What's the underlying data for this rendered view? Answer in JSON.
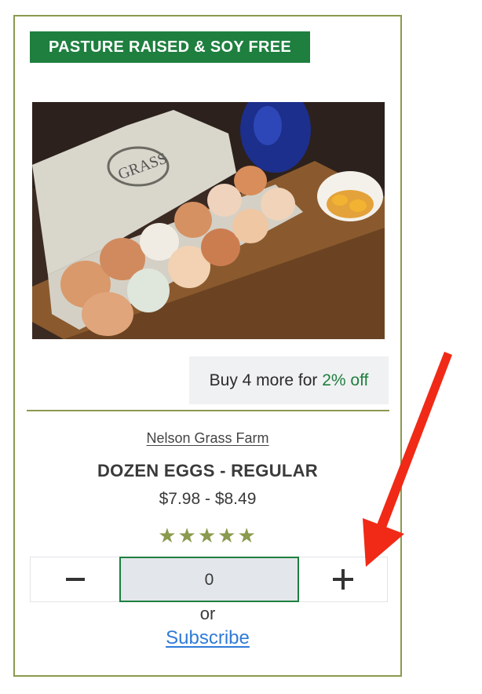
{
  "product": {
    "badge": "PASTURE RAISED & SOY FREE",
    "image_icon": "egg-carton-photo",
    "discount_prefix": "Buy 4 more for ",
    "discount_value": "2% off",
    "farm": "Nelson Grass Farm",
    "title": "DOZEN EGGS - REGULAR",
    "price": "$7.98 - $8.49",
    "rating": 5,
    "stars": "★★★★★"
  },
  "quantity": {
    "minus_icon": "minus-icon",
    "value": "0",
    "plus_icon": "plus-icon"
  },
  "subscribe": {
    "or_label": "or",
    "link_label": "Subscribe"
  },
  "colors": {
    "brand_green": "#1e7f3f",
    "border_olive": "#8a9a4e",
    "link_blue": "#2f7bd8",
    "arrow_red": "#f02a16"
  }
}
